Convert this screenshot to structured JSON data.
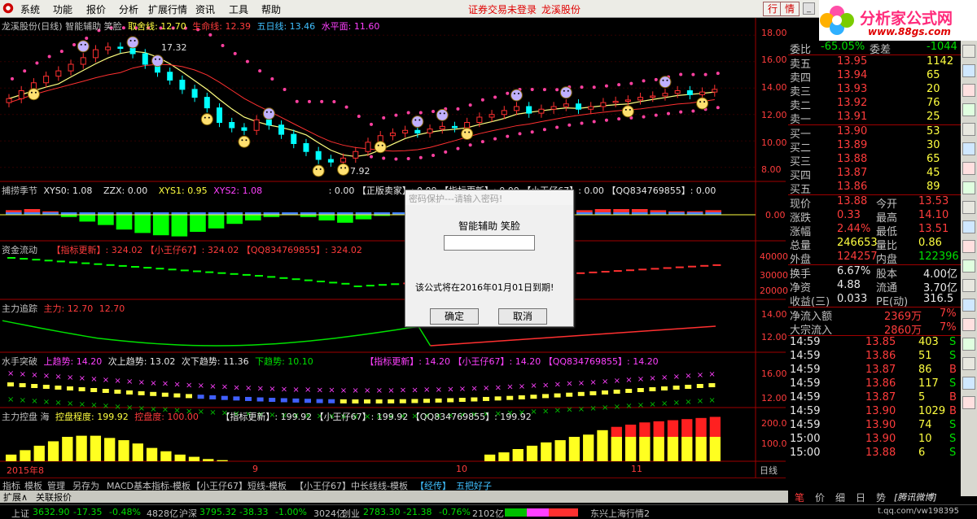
{
  "menu": {
    "items": [
      "系统",
      "功能",
      "报价",
      "分析",
      "扩展行情",
      "资讯",
      "工具",
      "帮助"
    ],
    "status_link": "证券交易未登录",
    "stock_link": "龙溪股份",
    "btn_trade": "行",
    "btn_info": "情"
  },
  "logo": {
    "text": "分析家公式网",
    "url": "www.88gs.com"
  },
  "main": {
    "title": "龙溪股份(日线) 智能辅助 笑脸",
    "ind1": "取舍线: 12.70",
    "ind2": "生命线: 12.39",
    "ind3": "五日线: 13.46",
    "ind4": "水平面: 11.60",
    "hi_label": "17.32",
    "lo_label": "7.92",
    "y_ticks": [
      "18.00",
      "16.00",
      "14.00",
      "12.00",
      "10.00",
      "8.00"
    ]
  },
  "panel2": {
    "title": "捕捞季节",
    "xys0": "XYS0: 1.08",
    "zzx": "ZZX: 0.00",
    "xys1": "XYS1: 0.95",
    "xys2": "XYS2: 1.08",
    "tail": ": 0.00 【正版卖家】: 0.00 【指标更新】: 0.00 【小王仔67】: 0.00 【QQ834769855】: 0.00",
    "y_tick": "0.00"
  },
  "panel3": {
    "title": "资金流动",
    "tail": "【指标更新】: 324.02 【小王仔67】: 324.02 【QQ834769855】: 324.02",
    "y_ticks": [
      "40000",
      "30000",
      "20000"
    ]
  },
  "panel4": {
    "title": "主力追踪",
    "v1": "主力: 12.70",
    "v2": "12.70",
    "y_ticks": [
      "14.00",
      "12.00"
    ]
  },
  "panel5": {
    "title": "水手突破",
    "up": "上趋势: 14.20",
    "up2": "次上趋势: 13.02",
    "down2": "次下趋势: 11.36",
    "down": "下趋势: 10.10",
    "tail": "【指标更新】: 14.20 【小王仔67】: 14.20 【QQ834769855】: 14.20",
    "y_ticks": [
      "16.00",
      "12.00"
    ]
  },
  "panel6": {
    "title": "主力控盘 海",
    "lvl": "控盘程度: 199.92",
    "tag": "控盘度: 100.00",
    "tail": "【指标更新】: 199.92 【小王仔67】: 199.92 【QQ834769855】: 199.92",
    "y_ticks": [
      "200.0",
      "100.0"
    ]
  },
  "x_axis": {
    "labels": [
      "2015年8",
      "9",
      "10",
      "11"
    ],
    "period": "日线"
  },
  "bottom_tabs": [
    "指标",
    "模板",
    "管理",
    "另存为",
    "MACD基本指标-模板",
    "【小王仔67】短线-模板",
    "【小王仔67】中长线线-模板",
    "【经传】",
    "五把好子"
  ],
  "tab_row2": [
    "扩展∧",
    "关联报价"
  ],
  "dialog": {
    "title": "密码保护---请输入密码!",
    "name": "智能辅助 笑脸",
    "message": "该公式将在2016年01月01日到期!",
    "ok": "确定",
    "cancel": "取消"
  },
  "quote": {
    "wei_bi_label": "委比",
    "wei_bi": "-65.05%",
    "wei_cha_label": "委差",
    "wei_cha": "-1044",
    "asks": [
      {
        "l": "卖五",
        "p": "13.95",
        "v": "1142"
      },
      {
        "l": "卖四",
        "p": "13.94",
        "v": "65"
      },
      {
        "l": "卖三",
        "p": "13.93",
        "v": "20"
      },
      {
        "l": "卖二",
        "p": "13.92",
        "v": "76"
      },
      {
        "l": "卖一",
        "p": "13.91",
        "v": "25"
      }
    ],
    "bids": [
      {
        "l": "买一",
        "p": "13.90",
        "v": "53"
      },
      {
        "l": "买二",
        "p": "13.89",
        "v": "30"
      },
      {
        "l": "买三",
        "p": "13.88",
        "v": "65"
      },
      {
        "l": "买四",
        "p": "13.87",
        "v": "45"
      },
      {
        "l": "买五",
        "p": "13.86",
        "v": "89"
      }
    ],
    "stats": [
      {
        "l1": "现价",
        "v1": "13.88",
        "l2": "今开",
        "v2": "13.53"
      },
      {
        "l1": "涨跌",
        "v1": "0.33",
        "l2": "最高",
        "v2": "14.10"
      },
      {
        "l1": "涨幅",
        "v1": "2.44%",
        "l2": "最低",
        "v2": "13.51"
      },
      {
        "l1": "总量",
        "v1": "246653",
        "l2": "量比",
        "v2": "0.86"
      },
      {
        "l1": "外盘",
        "v1": "124257",
        "l2": "内盘",
        "v2": "122396"
      }
    ],
    "stats2": [
      {
        "l1": "换手",
        "v1": "6.67%",
        "l2": "股本",
        "v2": "4.00亿"
      },
      {
        "l1": "净资",
        "v1": "4.88",
        "l2": "流通",
        "v2": "3.70亿"
      },
      {
        "l1": "收益(三)",
        "v1": "0.033",
        "l2": "PE(动)",
        "v2": "316.5"
      }
    ],
    "flow": [
      {
        "l": "净流入额",
        "v": "2369万",
        "p": "7%"
      },
      {
        "l": "大宗流入",
        "v": "2860万",
        "p": "7%"
      }
    ],
    "ticks": [
      {
        "t": "14:59",
        "p": "13.85",
        "v": "403",
        "d": "S"
      },
      {
        "t": "14:59",
        "p": "13.86",
        "v": "51",
        "d": "S"
      },
      {
        "t": "14:59",
        "p": "13.87",
        "v": "86",
        "d": "B"
      },
      {
        "t": "14:59",
        "p": "13.86",
        "v": "117",
        "d": "S"
      },
      {
        "t": "14:59",
        "p": "13.87",
        "v": "5",
        "d": "B"
      },
      {
        "t": "14:59",
        "p": "13.90",
        "v": "1029",
        "d": "B"
      },
      {
        "t": "14:59",
        "p": "13.90",
        "v": "74",
        "d": "S"
      },
      {
        "t": "15:00",
        "p": "13.90",
        "v": "10",
        "d": "S"
      },
      {
        "t": "15:00",
        "p": "13.88",
        "v": "6",
        "d": "S"
      }
    ]
  },
  "right_tabs": [
    "笔",
    "价",
    "细",
    "日",
    "势",
    "[腾讯微博]"
  ],
  "status": {
    "sh_label": "上证",
    "sh_val": "3632.90",
    "sh_chg": "-17.35",
    "sh_pct": "-0.48%",
    "sh_amt": "4828亿",
    "sz_label": "沪深",
    "sz_val": "3795.32",
    "sz_chg": "-38.33",
    "sz_pct": "-1.00%",
    "sz_amt": "3024亿",
    "cy_label": "创业",
    "cy_val": "2783.30",
    "cy_chg": "-21.38",
    "cy_pct": "-0.76%",
    "cy_amt": "2102亿",
    "server": "东兴上海行情2",
    "weibo": "t.qq.com/vw198395"
  },
  "chart_data": [
    {
      "type": "candlestick",
      "title": "龙溪股份(日线) 智能辅助 笑脸",
      "ylim": [
        7,
        19
      ],
      "x_labels": [
        "2015年8",
        "9",
        "10",
        "11"
      ],
      "series": [
        {
          "name": "取舍线",
          "last": 12.7
        },
        {
          "name": "生命线",
          "last": 12.39
        },
        {
          "name": "五日线",
          "last": 13.46
        },
        {
          "name": "水平面",
          "last": 11.6
        }
      ],
      "close": [
        13.2,
        13.8,
        14.4,
        14.9,
        15.3,
        15.8,
        16.3,
        16.9,
        17.1,
        17.0,
        16.6,
        15.8,
        15.2,
        14.6,
        13.9,
        13.3,
        12.5,
        11.4,
        11.0,
        10.8,
        11.6,
        11.2,
        10.5,
        9.8,
        9.2,
        8.6,
        8.4,
        8.7,
        9.2,
        9.9,
        10.4,
        10.6,
        10.8,
        10.6,
        10.9,
        11.1,
        11.0,
        11.4,
        11.8,
        12.0,
        12.3,
        12.6,
        12.1,
        12.4,
        12.6,
        12.8,
        12.4,
        12.6,
        12.9,
        13.0,
        13.1,
        13.3,
        13.4,
        13.6,
        13.8,
        13.5,
        13.7,
        13.9
      ]
    },
    {
      "type": "bar",
      "title": "捕捞季节",
      "values": [
        0.4,
        0.5,
        0.3,
        -0.2,
        -0.6,
        -0.9,
        -1.3,
        -1.6,
        -1.8,
        -1.9,
        -1.5,
        -1.2,
        -0.8,
        -0.5,
        -0.2,
        0.1,
        -0.2,
        -0.5,
        -0.7,
        -0.4,
        -0.1,
        0.1,
        0.2,
        0.3,
        0.3,
        0.4,
        0.4,
        0.5,
        0.4,
        0.5,
        0.5,
        0.4,
        0.5,
        0.5,
        0.5,
        0.4,
        0.3,
        0.3,
        0.4
      ]
    },
    {
      "type": "bar",
      "title": "主力控盘 海",
      "ylim": [
        0,
        220
      ],
      "values": [
        30,
        50,
        70,
        90,
        110,
        115,
        115,
        105,
        95,
        80,
        60,
        45,
        30,
        20,
        10,
        5,
        0,
        0,
        0,
        0,
        0,
        0,
        0,
        0,
        0,
        0,
        0,
        0,
        0,
        0,
        0,
        0,
        0,
        0,
        30,
        40,
        55,
        70,
        85,
        95,
        110,
        120,
        140,
        155,
        165,
        175,
        180,
        185,
        190,
        195,
        200
      ]
    }
  ]
}
